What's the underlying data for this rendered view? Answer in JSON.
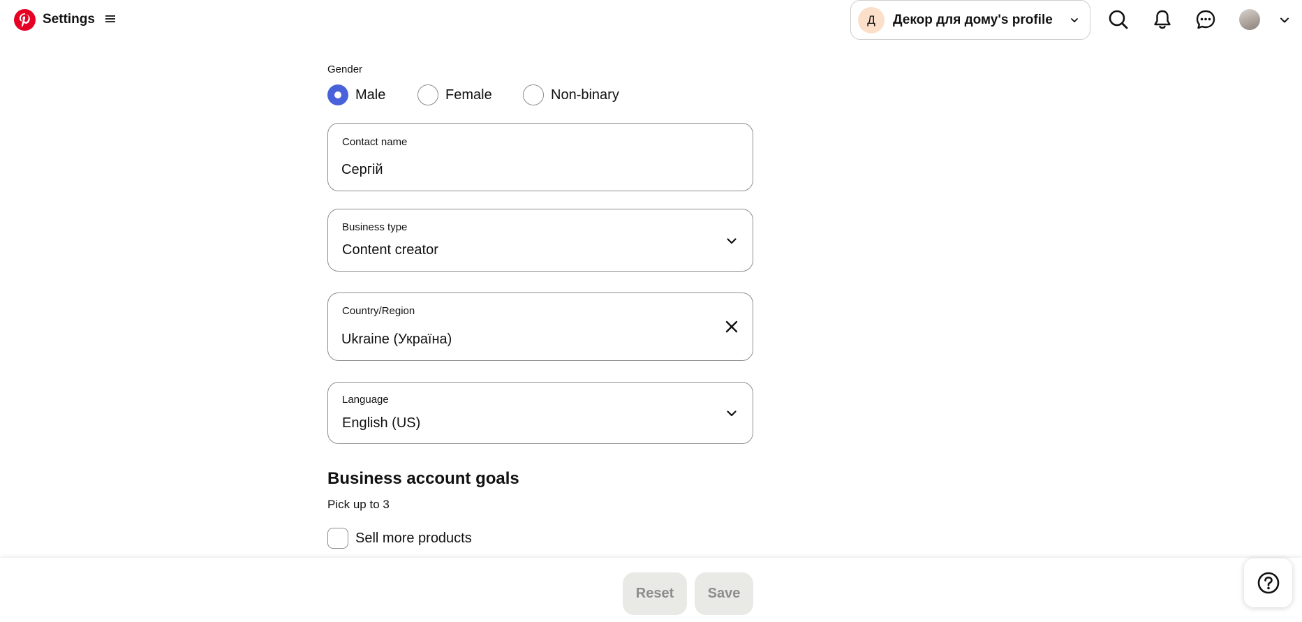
{
  "header": {
    "title": "Settings",
    "profile": {
      "initial": "Д",
      "name": "Декор для дому's profile"
    }
  },
  "form": {
    "gender": {
      "label": "Gender",
      "options": [
        "Male",
        "Female",
        "Non-binary"
      ],
      "selected": "Male"
    },
    "contact_name": {
      "label": "Contact name",
      "value": "Сергій"
    },
    "business_type": {
      "label": "Business type",
      "value": "Content creator"
    },
    "country": {
      "label": "Country/Region",
      "value": "Ukraine (Україна)"
    },
    "language": {
      "label": "Language",
      "value": "English (US)"
    }
  },
  "goals": {
    "title": "Business account goals",
    "subtitle": "Pick up to 3",
    "items": [
      {
        "label": "Sell more products",
        "checked": false
      }
    ]
  },
  "footer": {
    "reset_label": "Reset",
    "save_label": "Save"
  },
  "colors": {
    "brand": "#e60023",
    "accent": "#4a62d9",
    "disabled_button_bg": "#e9e9e6",
    "profile_avatar_bg": "#fbdfc9"
  },
  "icons": {
    "logo": "pinterest-logo",
    "menu": "hamburger-icon",
    "search": "search-icon",
    "notifications": "bell-icon",
    "messages": "chat-icon",
    "help": "help-icon",
    "clear": "close-icon",
    "dropdown": "chevron-down-icon"
  }
}
